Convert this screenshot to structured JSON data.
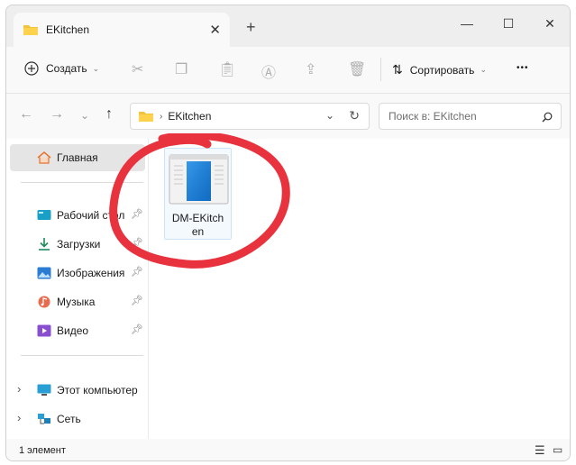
{
  "tab": {
    "title": "EKitchen",
    "close": "✕",
    "new_tab": "+"
  },
  "window_controls": {
    "minimize": "—",
    "maximize": "☐",
    "close": "✕"
  },
  "toolbar": {
    "create_label": "Создать",
    "sort_label": "Сортировать",
    "more": "•••"
  },
  "address": {
    "path": "EKitchen",
    "search_placeholder": "Поиск в: EKitchen"
  },
  "nav": {
    "home": "Главная",
    "desktop": "Рабочий стол",
    "downloads": "Загрузки",
    "pictures": "Изображения",
    "music": "Музыка",
    "video": "Видео",
    "computer": "Этот компьютер",
    "network": "Сеть"
  },
  "file": {
    "name_line1": "DM-EKitch",
    "name_line2": "en"
  },
  "status": {
    "count": "1 элемент"
  },
  "colors": {
    "accent": "#0067c0",
    "annotation": "#e8323e",
    "folder": "#f3c33c"
  }
}
